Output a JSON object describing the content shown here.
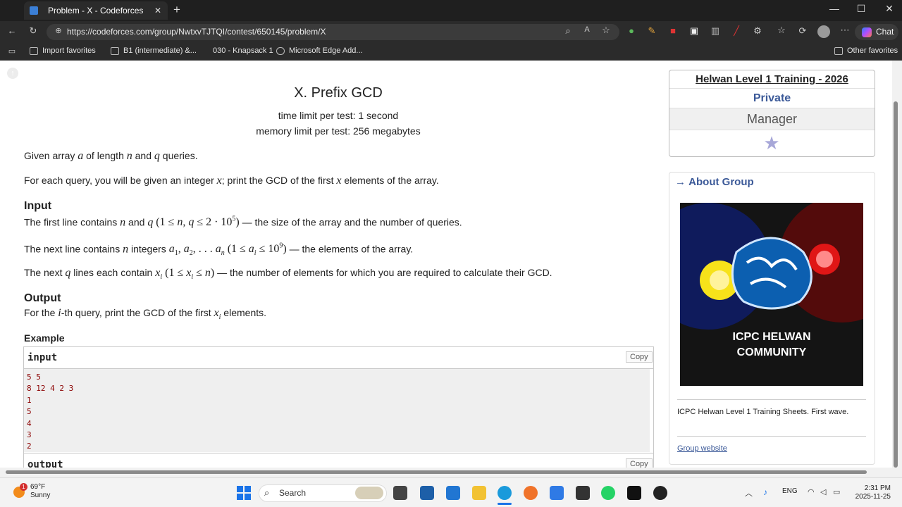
{
  "browser": {
    "tab_title": "Problem - X - Codeforces",
    "url": "https://codeforces.com/group/NwtxvTJTQI/contest/650145/problem/X",
    "chat_label": "Chat",
    "favorites": [
      {
        "label": "Import favorites"
      },
      {
        "label": "B1 (intermediate) &..."
      },
      {
        "label": "030 - Knapsack 1"
      },
      {
        "label": "Microsoft Edge Add..."
      }
    ],
    "other_favorites": "Other favorites"
  },
  "problem": {
    "title": "X. Prefix GCD",
    "time_limit": "time limit per test: 1 second",
    "memory_limit": "memory limit per test: 256 megabytes",
    "statement_1a": "Given array ",
    "statement_1b": " of length ",
    "statement_1c": " and ",
    "statement_1d": " queries.",
    "statement_2a": "For each query, you will be given an integer ",
    "statement_2b": "; print the GCD of the first ",
    "statement_2c": " elements of the array.",
    "input_header": "Input",
    "input_1a": "The first line contains ",
    "input_1b": " and ",
    "input_1c": " — the size of the array and the number of queries.",
    "input_2a": "The next line contains ",
    "input_2b": " integers ",
    "input_2c": " — the elements of the array.",
    "input_3a": "The next ",
    "input_3b": " lines each contain ",
    "input_3c": " — the number of elements for which you are required to calculate their GCD.",
    "output_header": "Output",
    "output_a": "For the ",
    "output_b": "-th query, print the GCD of the first ",
    "output_c": " elements.",
    "example_header": "Example",
    "sample_input_label": "input",
    "sample_output_label": "output",
    "copy_label": "Copy",
    "sample_input": "5 5\n8 12 4 2 3\n1\n5\n4\n3\n2"
  },
  "sidebar": {
    "group_name": "Helwan Level 1 Training - 2026",
    "privacy": "Private",
    "role": "Manager",
    "about_header": "About Group",
    "logo_text_1": "ICPC HELWAN",
    "logo_text_2": "COMMUNITY",
    "description": "ICPC Helwan Level 1 Training Sheets. First wave.",
    "group_website": "Group website"
  },
  "taskbar": {
    "temperature": "69°F",
    "weather": "Sunny",
    "search_placeholder": "Search",
    "language": "ENG",
    "time": "2:31 PM",
    "date": "2025-11-25"
  }
}
